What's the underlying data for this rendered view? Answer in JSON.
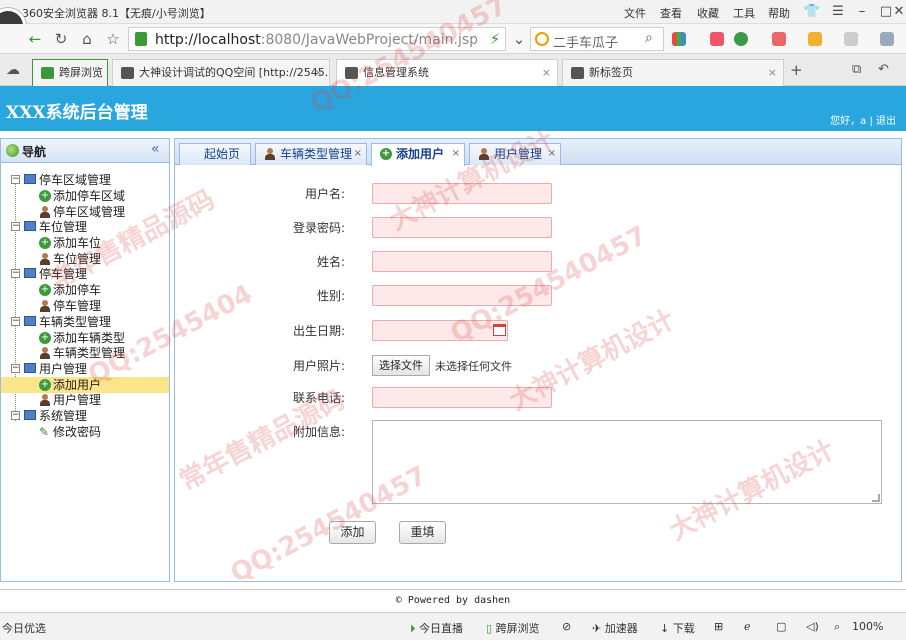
{
  "browser": {
    "window_title": "360安全浏览器 8.1【无痕/小号浏览】",
    "menu": [
      "文件",
      "查看",
      "收藏",
      "工具",
      "帮助"
    ],
    "url_host": "http://localhost",
    "url_rest": ":8080/JavaWebProject/main.jsp",
    "search_text": "二手车瓜子",
    "tabs": [
      {
        "label": "跨屏浏览"
      },
      {
        "label": "大神设计调试的QQ空间 [http://2545..."
      },
      {
        "label": "信息管理系统"
      },
      {
        "label": "新标签页"
      }
    ]
  },
  "app": {
    "title": "XXX系统后台管理",
    "greeting": "您好，a | 退出"
  },
  "sidebar": {
    "title": "导航",
    "groups": [
      {
        "label": "停车区域管理",
        "items": [
          "添加停车区域",
          "停车区域管理"
        ]
      },
      {
        "label": "车位管理",
        "items": [
          "添加车位",
          "车位管理"
        ]
      },
      {
        "label": "停车管理",
        "items": [
          "添加停车",
          "停车管理"
        ]
      },
      {
        "label": "车辆类型管理",
        "items": [
          "添加车辆类型",
          "车辆类型管理"
        ]
      },
      {
        "label": "用户管理",
        "items": [
          "添加用户",
          "用户管理"
        ]
      },
      {
        "label": "系统管理",
        "items": [
          "修改密码"
        ]
      }
    ]
  },
  "content": {
    "tabs": [
      {
        "label": "起始页"
      },
      {
        "label": "车辆类型管理"
      },
      {
        "label": "添加用户"
      },
      {
        "label": "用户管理"
      }
    ],
    "form": {
      "username_label": "用户名:",
      "password_label": "登录密码:",
      "name_label": "姓名:",
      "gender_label": "性别:",
      "birthday_label": "出生日期:",
      "photo_label": "用户照片:",
      "file_button": "选择文件",
      "file_status": "未选择任何文件",
      "phone_label": "联系电话:",
      "extra_label": "附加信息:",
      "submit": "添加",
      "reset": "重填"
    }
  },
  "footer": "© Powered by dashen",
  "statusbar": {
    "left": "今日优选",
    "items": [
      "今日直播",
      "跨屏浏览",
      "加速器",
      "下载"
    ],
    "zoom": "100%"
  },
  "watermarks": [
    "QQ:254540457",
    "大神计算机设计",
    "常年售精品源码",
    "QQ:2545404",
    "大神计算机设计",
    "常年售精品源码",
    "QQ:254540457",
    "QQ:254540457",
    "大神计算机设计"
  ]
}
